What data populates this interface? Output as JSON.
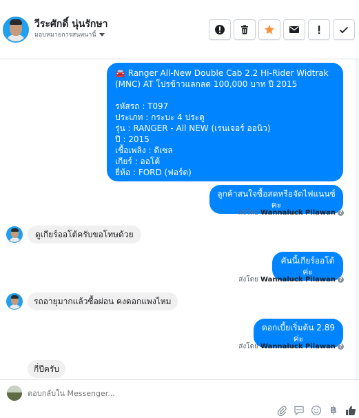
{
  "header": {
    "name": "วีระศักดิ์ นุ่นรักษา",
    "assign_label": "มอบหมายการสนทนานี้",
    "actions": [
      "alert-circle-icon",
      "trash-icon",
      "star-icon",
      "envelope-icon",
      "exclamation-icon",
      "check-icon"
    ]
  },
  "colors": {
    "accent": "#0084ff",
    "incoming_bubble": "#f1f0f0",
    "star": "#f7923b",
    "icon_gray": "#606770"
  },
  "messages": [
    {
      "direction": "out",
      "text": "🚘 Ranger All-New Double Cab 2.2 Hi-Rider Widtrak (MNC) AT โปรข้าวแลกลด 100,000 บาท ปี 2015\n\nรหัสรถ : T097\nประเภท : กระบะ 4 ประตู\nรุ่น : RANGER - All NEW (เรนเจอร์ ออนิว)\nปี : 2015\nเชื้อเพลิง : ดีเซล\nเกียร์ : ออโต้\nยี่ห้อ : FORD (ฟอร์ด)"
    },
    {
      "direction": "out",
      "text": "ลูกค้าสนใจซื้อสดหรือจัดไฟแนนซ์คะ"
    },
    {
      "direction": "in",
      "text": "ดูเกียร์ออโต้ครับขอโทษด้วย"
    },
    {
      "direction": "out",
      "text": "คันนี้เกียร์ออโต้ค่ะ"
    },
    {
      "direction": "in",
      "text": "รถอายุมากแล้วซื้อผ่อน คงดอกแพงไหม"
    },
    {
      "direction": "out",
      "text": "ดอกเบี้ยเริ่มต้น 2.89 ค่ะ"
    },
    {
      "direction": "in",
      "text": "กี่ปีครับ"
    }
  ],
  "sent_by": {
    "prefix": "ส่งโดย",
    "agent": "Wannaluck Pilawan"
  },
  "composer": {
    "placeholder": "ตอบกลับใน Messenger...",
    "tools": [
      "paperclip-icon",
      "message-template-icon",
      "emoji-icon",
      "baht-icon",
      "thumbs-up-icon"
    ],
    "baht_symbol": "฿"
  }
}
